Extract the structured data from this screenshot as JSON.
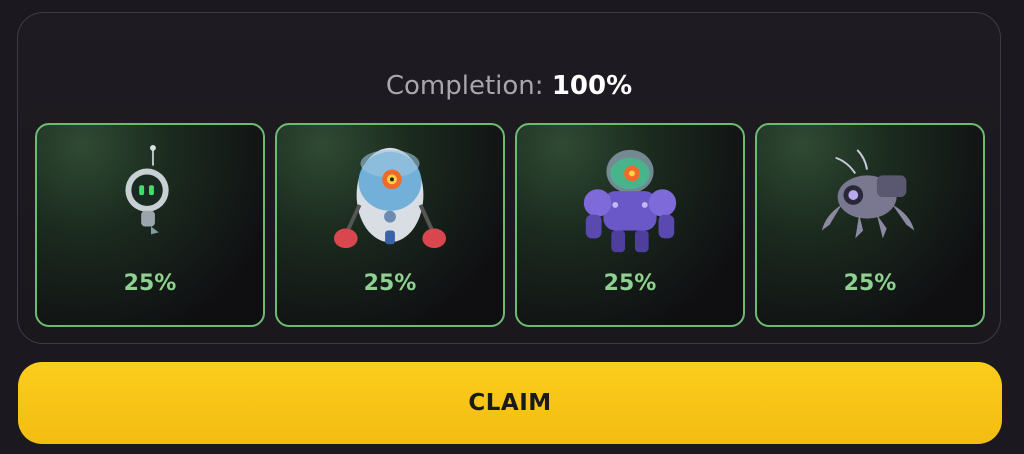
{
  "completion": {
    "label": "Completion:",
    "value": "100%"
  },
  "cards": [
    {
      "percent": "25%",
      "icon": "small-astronaut-robot-icon"
    },
    {
      "percent": "25%",
      "icon": "boxer-robot-icon"
    },
    {
      "percent": "25%",
      "icon": "mech-robot-icon"
    },
    {
      "percent": "25%",
      "icon": "spider-robot-icon"
    }
  ],
  "claim_button": {
    "label": "CLAIM"
  },
  "colors": {
    "accent_green": "#6dbb73",
    "claim_yellow": "#f9c517",
    "background": "#1b1820"
  }
}
